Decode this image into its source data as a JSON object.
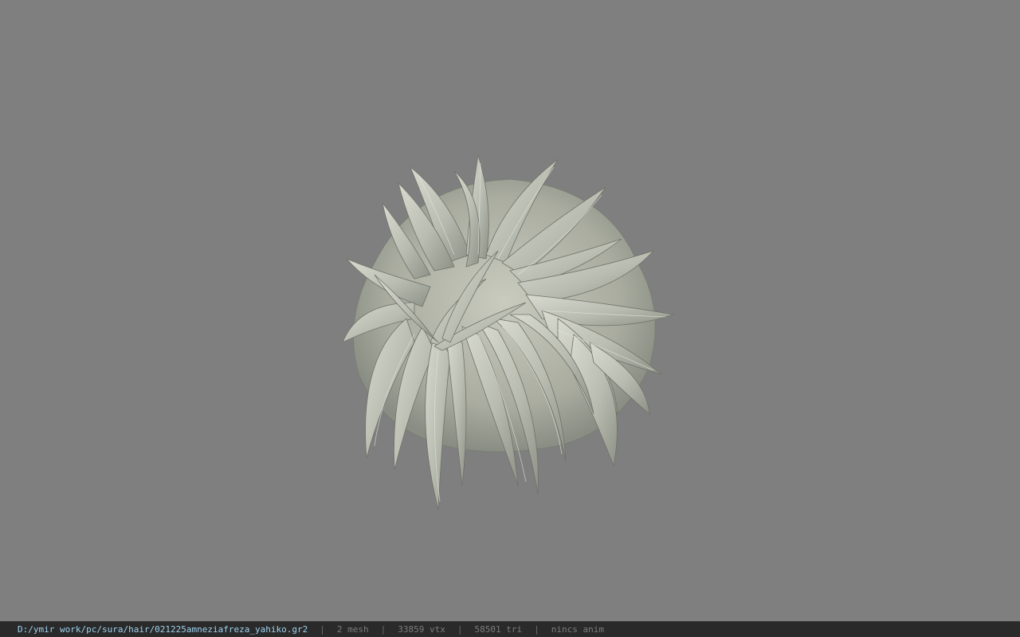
{
  "viewport": {
    "background_color": "#7f7f7f",
    "model": {
      "hair_color": "#c6c8bc",
      "hair_shadow_color": "#8d8f85",
      "scalp_color": "#6b3a2a"
    }
  },
  "statusbar": {
    "file_path": "D:/ymir work/pc/sura/hair/021225amneziafreza_yahiko.gr2",
    "separator": "|",
    "mesh_count": "2 mesh",
    "vertex_count": "33859 vtx",
    "triangle_count": "58501 tri",
    "anim_status": "nincs anim"
  }
}
